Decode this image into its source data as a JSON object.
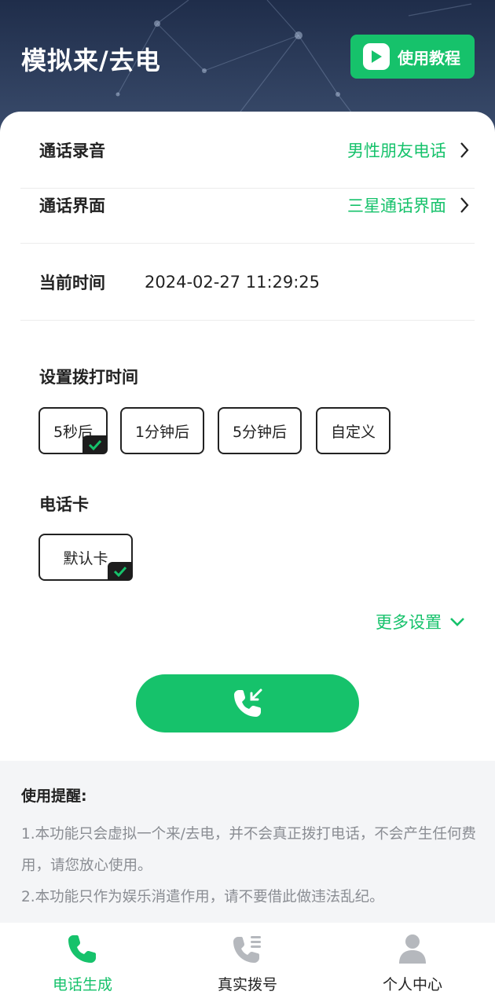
{
  "header": {
    "title": "模拟来/去电",
    "tutorial_label": "使用教程"
  },
  "settings": {
    "recording": {
      "label": "通话录音",
      "value": "男性朋友电话"
    },
    "interface": {
      "label": "通话界面",
      "value": "三星通话界面"
    },
    "current_time": {
      "label": "当前时间",
      "value": "2024-02-27 11:29:25"
    }
  },
  "dial_time": {
    "title": "设置拨打时间",
    "options": [
      "5秒后",
      "1分钟后",
      "5分钟后",
      "自定义"
    ],
    "selected": "5秒后"
  },
  "sim": {
    "title": "电话卡",
    "options": [
      "默认卡"
    ],
    "selected": "默认卡"
  },
  "more_settings_label": "更多设置",
  "tips": {
    "title": "使用提醒:",
    "line1": "1.本功能只会虚拟一个来/去电，并不会真正拨打电话，不会产生任何费用，请您放心使用。",
    "line2": "2.本功能只作为娱乐消遣作用，请不要借此做违法乱纪。"
  },
  "tabs": [
    {
      "label": "电话生成",
      "icon": "phone-icon",
      "active": true
    },
    {
      "label": "真实拨号",
      "icon": "phone-list-icon",
      "active": false
    },
    {
      "label": "个人中心",
      "icon": "person-icon",
      "active": false
    }
  ],
  "colors": {
    "accent": "#16c26b",
    "header_bg": "#2a3856",
    "tab_inactive": "#b5b8bd"
  }
}
